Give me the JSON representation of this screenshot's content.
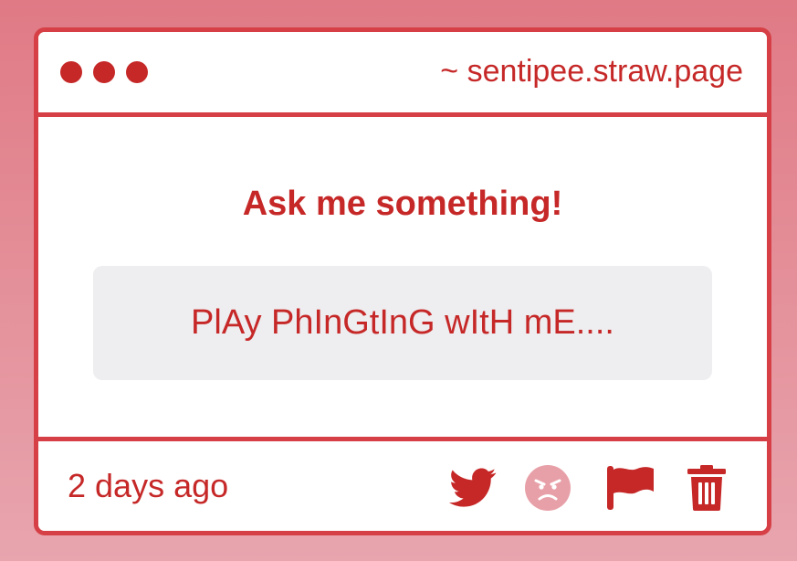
{
  "window": {
    "url": "~ sentipee.straw.page"
  },
  "content": {
    "prompt": "Ask me something!",
    "question": "PlAy PhInGtInG wItH mE...."
  },
  "footer": {
    "time": "2 days ago",
    "actions": [
      "twitter-icon",
      "angry-face-icon",
      "flag-icon",
      "trash-icon"
    ]
  },
  "colors": {
    "accent": "#c62828",
    "border": "#d63f45",
    "background_top": "#e07a85",
    "background_bottom": "#e8a5ae",
    "box": "#eeedef",
    "angry_face": "#e8a0a8"
  }
}
